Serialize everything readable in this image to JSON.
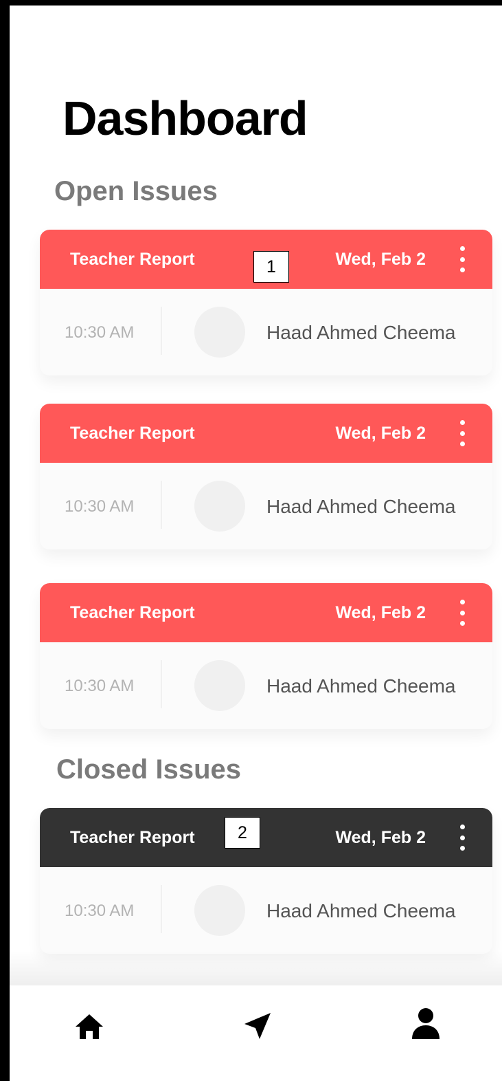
{
  "page": {
    "title": "Dashboard"
  },
  "sections": {
    "open_title": "Open Issues",
    "closed_title": "Closed Issues"
  },
  "open_issues": [
    {
      "type": "Teacher Report",
      "date": "Wed, Feb 2",
      "time": "10:30 AM",
      "name": "Haad Ahmed Cheema"
    },
    {
      "type": "Teacher Report",
      "date": "Wed, Feb 2",
      "time": "10:30 AM",
      "name": "Haad Ahmed Cheema"
    },
    {
      "type": "Teacher Report",
      "date": "Wed, Feb 2",
      "time": "10:30 AM",
      "name": "Haad Ahmed Cheema"
    }
  ],
  "closed_issues": [
    {
      "type": "Teacher Report",
      "date": "Wed, Feb 2",
      "time": "10:30 AM",
      "name": "Haad Ahmed Cheema"
    }
  ],
  "annotations": [
    "1",
    "2"
  ],
  "colors": {
    "open_header": "#ff5858",
    "closed_header": "#333333",
    "section_title": "#7a7a7a",
    "card_body": "#fbfbfb",
    "avatar_placeholder": "#f0f0f0"
  },
  "nav": {
    "items": [
      {
        "icon": "home-icon"
      },
      {
        "icon": "send-icon"
      },
      {
        "icon": "profile-icon"
      }
    ]
  }
}
